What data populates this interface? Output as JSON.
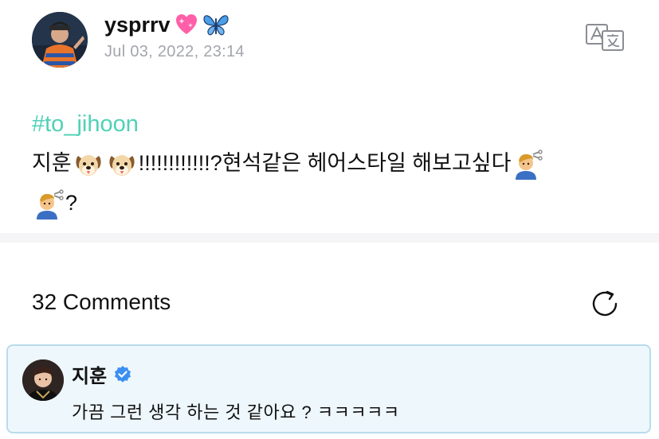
{
  "post": {
    "username": "ysprrv",
    "timestamp": "Jul 03, 2022, 23:14",
    "hashtag": "#to_jihoon",
    "body_name": "지훈",
    "body_exclaim": "!!!!!!!!!!!!?현석같은 헤어스타일 해보고싶다",
    "body_end": "?"
  },
  "icons": {
    "username_emojis": [
      "sparkling-heart-icon",
      "butterfly-icon"
    ],
    "body_emojis": [
      "dog-face-icon",
      "dog-face-icon",
      "man-getting-haircut-icon",
      "man-getting-haircut-icon"
    ],
    "translate": "translate-icon",
    "refresh": "refresh-icon",
    "verified": "verified-badge-icon"
  },
  "comments": {
    "count_label": "32 Comments",
    "items": [
      {
        "author": "지훈",
        "verified": true,
        "text": "가끔 그런 생각 하는 것 같아요 ? ㅋㅋㅋㅋㅋ"
      }
    ]
  },
  "colors": {
    "hashtag": "#4fd1b6",
    "timestamp": "#a3a6ac",
    "verified": "#3b8ff2",
    "comment_bg": "#eef7fc",
    "comment_border": "#b9dced"
  }
}
